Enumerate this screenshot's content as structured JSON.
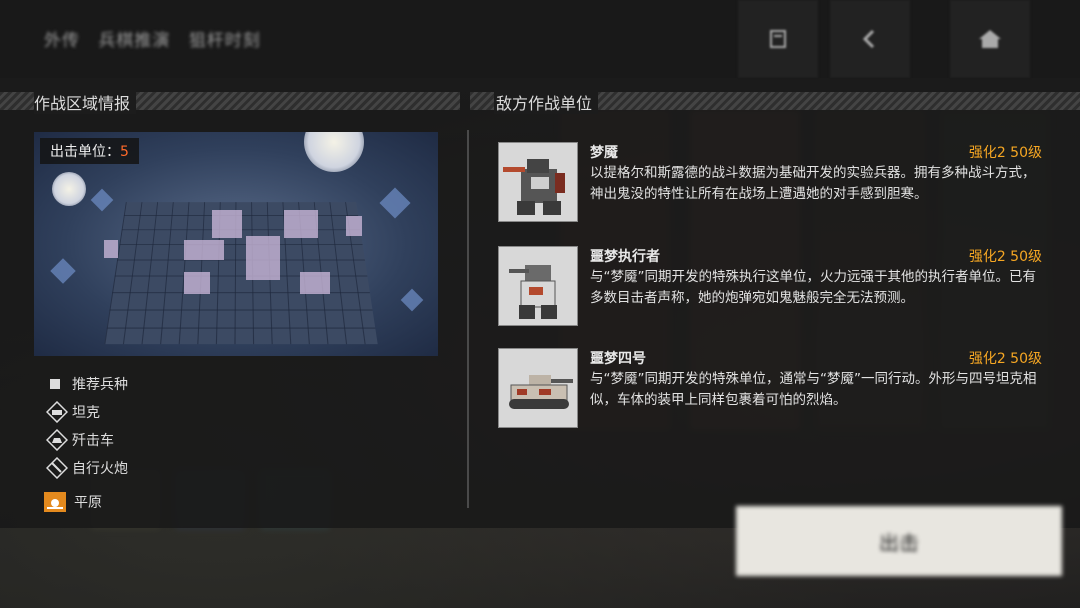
{
  "top_bar": {
    "breadcrumbs": [
      "外传",
      "兵棋推演",
      "狙杆时刻"
    ],
    "buttons": [
      "archive-icon",
      "back-icon",
      "home-icon"
    ]
  },
  "zone_section": {
    "title": "作战区域情报",
    "deploy_label": "出击单位：",
    "deploy_count": "5",
    "recommended_label": "推荐兵种",
    "unit_types": [
      "坦克",
      "歼击车",
      "自行火炮"
    ],
    "terrain": "平原"
  },
  "enemy_section": {
    "title": "敌方作战单位",
    "enemies": [
      {
        "name": "梦魇",
        "level": "强化2 50级",
        "description": "以提格尔和斯露德的战斗数据为基础开发的实验兵器。拥有多种战斗方式，神出鬼没的特性让所有在战场上遭遇她的对手感到胆寒。"
      },
      {
        "name": "噩梦执行者",
        "level": "强化2 50级",
        "description": "与“梦魇”同期开发的特殊执行这单位，火力远强于其他的执行者单位。已有多数目击者声称，她的炮弹宛如鬼魅般完全无法预测。"
      },
      {
        "name": "噩梦四号",
        "level": "强化2 50级",
        "description": "与“梦魇”同期开发的特殊单位，通常与“梦魇”一同行动。外形与四号坦克相似，车体的装甲上同样包裹着可怕的烈焰。"
      }
    ]
  },
  "bottom": {
    "deploy_button": "出击"
  },
  "colors": {
    "accent_orange": "#f5a623",
    "deploy_count": "#ff6a2a"
  }
}
